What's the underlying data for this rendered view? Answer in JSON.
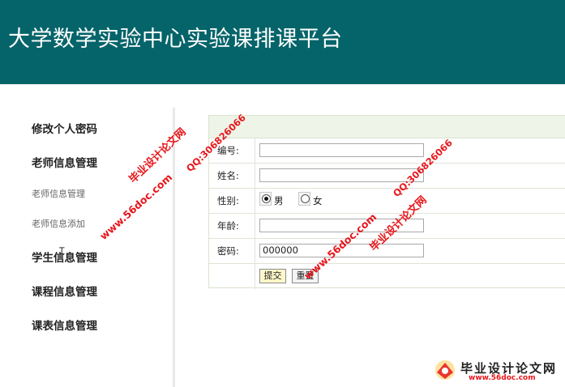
{
  "header": {
    "title": "大学数学实验中心实验课排课平台"
  },
  "sidebar": {
    "items": [
      {
        "label": "修改个人密码"
      },
      {
        "label": "老师信息管理"
      },
      {
        "label": "老师信息管理"
      },
      {
        "label": "老师信息添加"
      },
      {
        "label": "学生信息管理"
      },
      {
        "label": "课程信息管理"
      },
      {
        "label": "课表信息管理"
      }
    ]
  },
  "form": {
    "fields": [
      {
        "label": "编号:",
        "value": ""
      },
      {
        "label": "姓名:",
        "value": ""
      },
      {
        "label": "性别:",
        "options": [
          "男",
          "女"
        ],
        "selected": "男"
      },
      {
        "label": "年龄:",
        "value": ""
      },
      {
        "label": "密码:",
        "value": "000000"
      }
    ],
    "submit_label": "提交",
    "reset_label": "重置"
  },
  "watermarks": {
    "site_name": "毕业设计论文网",
    "url": "www.56doc.com",
    "qq": "QQ:306826066",
    "logo_text": "毕业设计论文网",
    "logo_url": "www.56doc.com"
  },
  "colors": {
    "header_bg": "#05646a",
    "watermark": "#e8161b",
    "form_header_bg": "#eef4e8"
  }
}
